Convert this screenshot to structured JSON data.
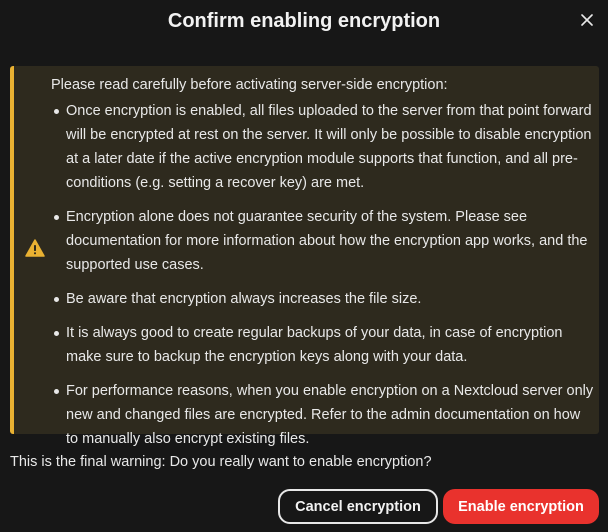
{
  "dialog": {
    "title": "Confirm enabling encryption",
    "close_icon": "close-icon",
    "warning": {
      "icon": "warning-icon",
      "accent_color": "#e9b132",
      "intro": "Please read carefully before activating server-side encryption:",
      "items": [
        "Once encryption is enabled, all files uploaded to the server from that point forward will be encrypted at rest on the server. It will only be possible to disable encryption at a later date if the active encryption module supports that function, and all pre-conditions (e.g. setting a recover key) are met.",
        "Encryption alone does not guarantee security of the system. Please see documentation for more information about how the encryption app works, and the supported use cases.",
        "Be aware that encryption always increases the file size.",
        "It is always good to create regular backups of your data, in case of encryption make sure to backup the encryption keys along with your data.",
        "For performance reasons, when you enable encryption on a Nextcloud server only new and changed files are encrypted. Refer to the admin documentation on how to manually also encrypt existing files."
      ]
    },
    "final_warning": "This is the final warning: Do you really want to enable encryption?",
    "buttons": {
      "cancel_label": "Cancel encryption",
      "enable_label": "Enable encryption",
      "enable_color": "#e9322d"
    }
  }
}
